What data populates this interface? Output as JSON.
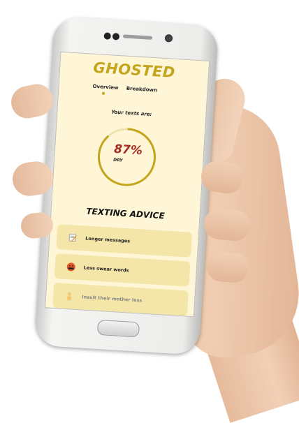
{
  "app": {
    "title": "GHOSTED"
  },
  "tabs": [
    {
      "label": "Overview",
      "active": true
    },
    {
      "label": "Breakdown",
      "active": false
    }
  ],
  "overview": {
    "subtitle": "Your texts are:",
    "percent_text": "87%",
    "percent_value": 87,
    "label": "DRY"
  },
  "advice": {
    "title": "TEXTING ADVICE",
    "items": [
      {
        "label": "Longer messages",
        "icon": "memo-icon"
      },
      {
        "label": "Less swear words",
        "icon": "angry-face-icon"
      },
      {
        "label": "Insult their mother less",
        "icon": "person-icon"
      }
    ]
  },
  "colors": {
    "accent": "#c4a51e",
    "background": "#fef6d6",
    "card": "#f3e6a8",
    "percent": "#a52d23"
  }
}
